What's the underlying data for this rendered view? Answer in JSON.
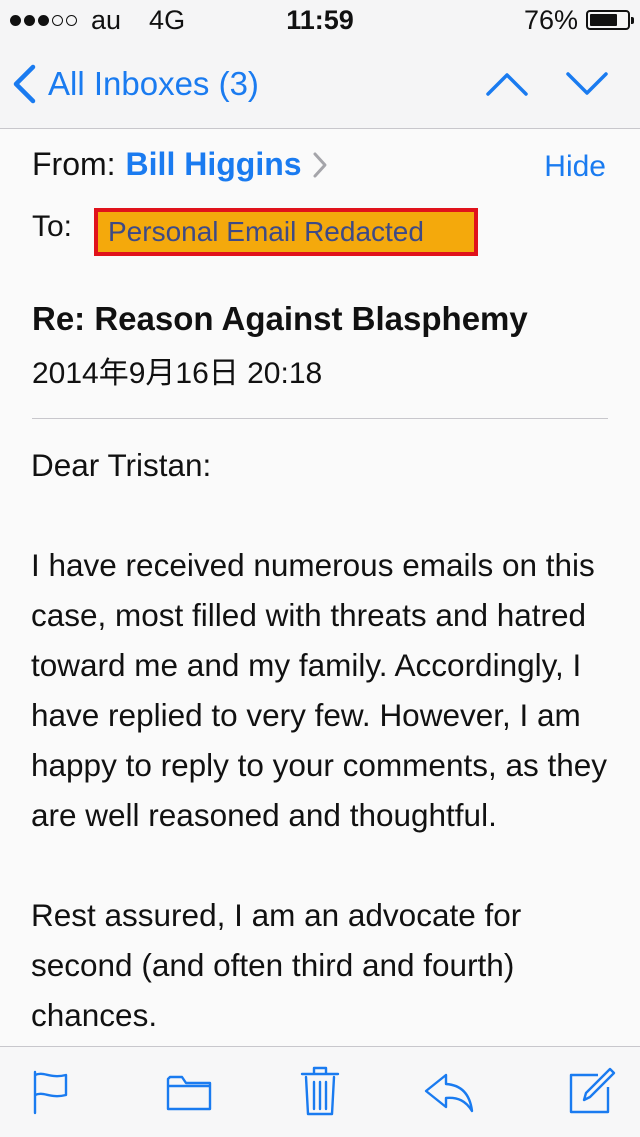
{
  "status_bar": {
    "carrier": "au",
    "network": "4G",
    "time": "11:59",
    "battery_text": "76%",
    "battery_level": 0.76,
    "signal_strength": 3,
    "signal_max": 5
  },
  "nav": {
    "back_label": "All Inboxes (3)",
    "accent_color": "#1a7bf0"
  },
  "header": {
    "from_label": "From:",
    "sender": "Bill Higgins",
    "hide_label": "Hide",
    "to_label": "To:",
    "redaction_text": "Personal Email Redacted",
    "subject": "Re: Reason Against Blasphemy",
    "date": "2014年9月16日 20:18"
  },
  "body": {
    "paragraphs": [
      "Dear Tristan:",
      "I have received numerous emails on this case, most filled with threats and hatred toward me and my family. Accordingly, I have replied to very few. However, I am happy to reply to your comments, as they are well reasoned and thoughtful.",
      "Rest assured, I am an advocate for second (and often third and fourth) chances."
    ]
  },
  "toolbar": {
    "icons": [
      "flag-icon",
      "folder-icon",
      "trash-icon",
      "reply-icon",
      "compose-icon"
    ]
  }
}
